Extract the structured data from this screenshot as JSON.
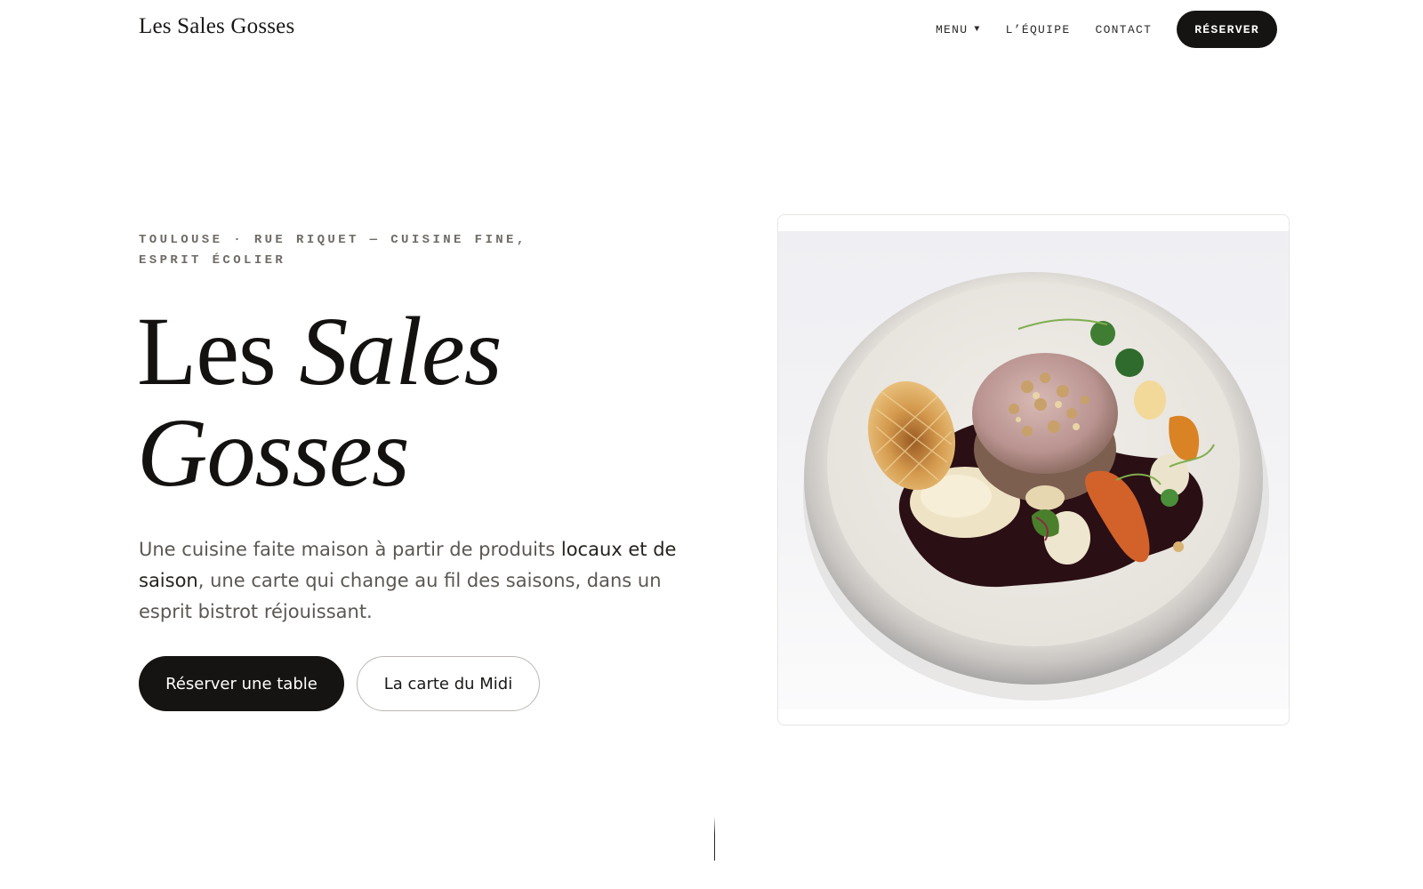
{
  "header": {
    "logo": "Les Sales Gosses",
    "nav": [
      {
        "label": "MENU",
        "has_dropdown": true
      },
      {
        "label": "L’ÉQUIPE"
      },
      {
        "label": "CONTACT"
      }
    ],
    "cta_label": "RÉSERVER"
  },
  "hero": {
    "eyebrow": "TOULOUSE · RUE RIQUET — CUISINE FINE, ESPRIT ÉCOLIER",
    "title_regular": "Les ",
    "title_italic": "Sales Gosses",
    "lead_part1": "Une cuisine faite maison à partir de produits ",
    "lead_emphasis": "locaux et de saison",
    "lead_part2": ", une carte qui change au fil des saisons, dans un esprit bistrot réjouissant.",
    "primary_button": "Réserver une table",
    "secondary_button": "La carte du Midi"
  },
  "icons": {
    "menu_caret": "caret-down-icon"
  },
  "colors": {
    "ink": "#161412",
    "muted": "#6f6b66",
    "background": "#ffffff",
    "border": "#bcb8b3"
  }
}
